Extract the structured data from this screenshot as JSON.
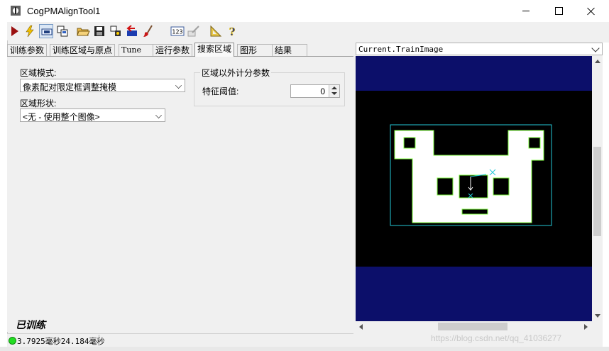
{
  "window": {
    "title": "CogPMAlignTool1",
    "controls": [
      "minimize",
      "maximize",
      "close"
    ]
  },
  "toolbar": {
    "icons": [
      "run-icon",
      "flash-icon",
      "display-toggle-icon",
      "copy-image-icon",
      "open-icon",
      "save-icon",
      "settings-icon",
      "reset-icon",
      "brush-icon",
      "counter-icon",
      "edit-icon",
      "ruler-icon",
      "help-icon"
    ],
    "counter_text": "123"
  },
  "tabs": [
    {
      "label": "训练参数",
      "active": false
    },
    {
      "label": "训练区域与原点",
      "active": false
    },
    {
      "label": "Tune",
      "active": false
    },
    {
      "label": "运行参数",
      "active": false
    },
    {
      "label": "搜索区域",
      "active": true
    },
    {
      "label": "图形",
      "active": false
    },
    {
      "label": "结果",
      "active": false
    }
  ],
  "search_region": {
    "mode_label": "区域模式:",
    "mode_value": "像素配对限定框调整掩模",
    "shape_label": "区域形状:",
    "shape_value": "<无 - 使用整个图像>",
    "outside_group_title": "区域以外计分参数",
    "threshold_label": "特征阈值:",
    "threshold_value": "0"
  },
  "status": {
    "trained": "已训练",
    "timing": "3.7925毫秒24.184毫秒",
    "led_color": "#22dd22"
  },
  "display": {
    "image_name": "Current.TrainImage",
    "background_color": "#0c0f6a"
  },
  "watermark": "https://blog.csdn.net/qq_41036277"
}
